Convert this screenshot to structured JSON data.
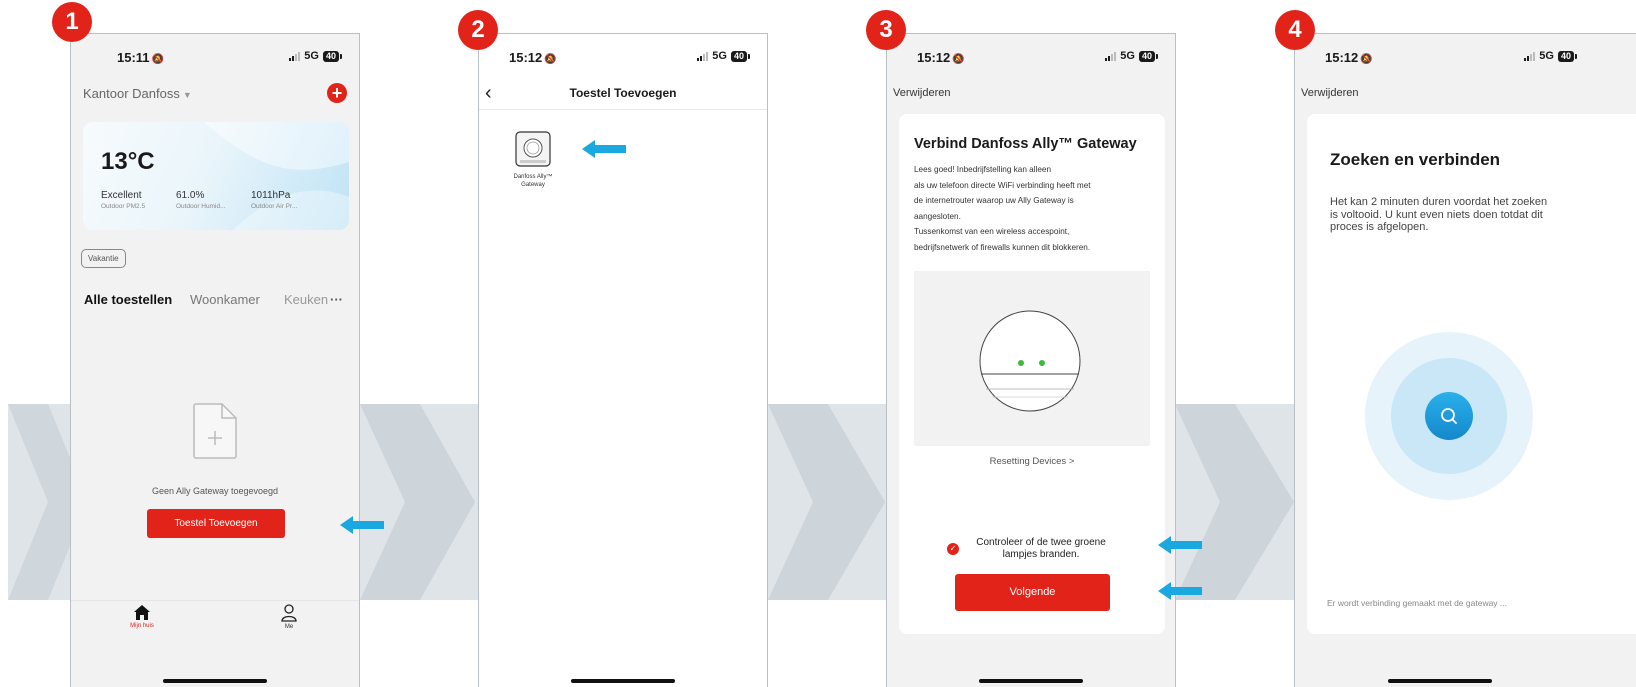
{
  "colors": {
    "accent": "#e2231a",
    "arrow": "#1aa8e0",
    "band": "#dfe4e8"
  },
  "steps": [
    "1",
    "2",
    "3",
    "4"
  ],
  "status": {
    "phone1_time": "15:11",
    "phone2_time": "15:12",
    "phone3_time": "15:12",
    "phone4_time": "15:12",
    "network": "5G",
    "battery": "40"
  },
  "phone1": {
    "home_title": "Kantoor Danfoss",
    "weather": {
      "temp": "13°C",
      "stats": [
        {
          "value": "Excellent",
          "label": "Outdoor PM2.5"
        },
        {
          "value": "61.0%",
          "label": "Outdoor Humid..."
        },
        {
          "value": "1011hPa",
          "label": "Outdoor Air Pr..."
        }
      ]
    },
    "vacation_chip": "Vakantie",
    "tabs": [
      "Alle toestellen",
      "Woonkamer",
      "Keuken"
    ],
    "tabs_more": "···",
    "empty_text": "Geen Ally Gateway toegevoegd",
    "add_button": "Toestel Toevoegen",
    "nav": [
      "Mijn huis",
      "Me"
    ]
  },
  "phone2": {
    "title": "Toestel Toevoegen",
    "device_label": "Danfoss Ally™ Gateway"
  },
  "phone3": {
    "remove": "Verwijderen",
    "title": "Verbind Danfoss Ally™ Gateway",
    "body_lines": [
      "Lees goed! Inbedrijfstelling kan alleen",
      "als uw telefoon directe WiFi verbinding heeft met",
      "de internetrouter waarop uw Ally Gateway is",
      "aangesloten.",
      "Tussenkomst van een wireless accespoint,",
      "bedrijfsnetwerk of firewalls kunnen dit blokkeren."
    ],
    "reset_link": "Resetting Devices >",
    "check_text": "Controleer of de twee groene lampjes branden.",
    "next_button": "Volgende"
  },
  "phone4": {
    "remove": "Verwijderen",
    "title": "Zoeken en verbinden",
    "body": "Het kan 2 minuten duren voordat het zoeken is voltooid. U kunt even niets doen totdat dit proces is afgelopen.",
    "footer": "Er wordt verbinding gemaakt met de gateway ..."
  }
}
